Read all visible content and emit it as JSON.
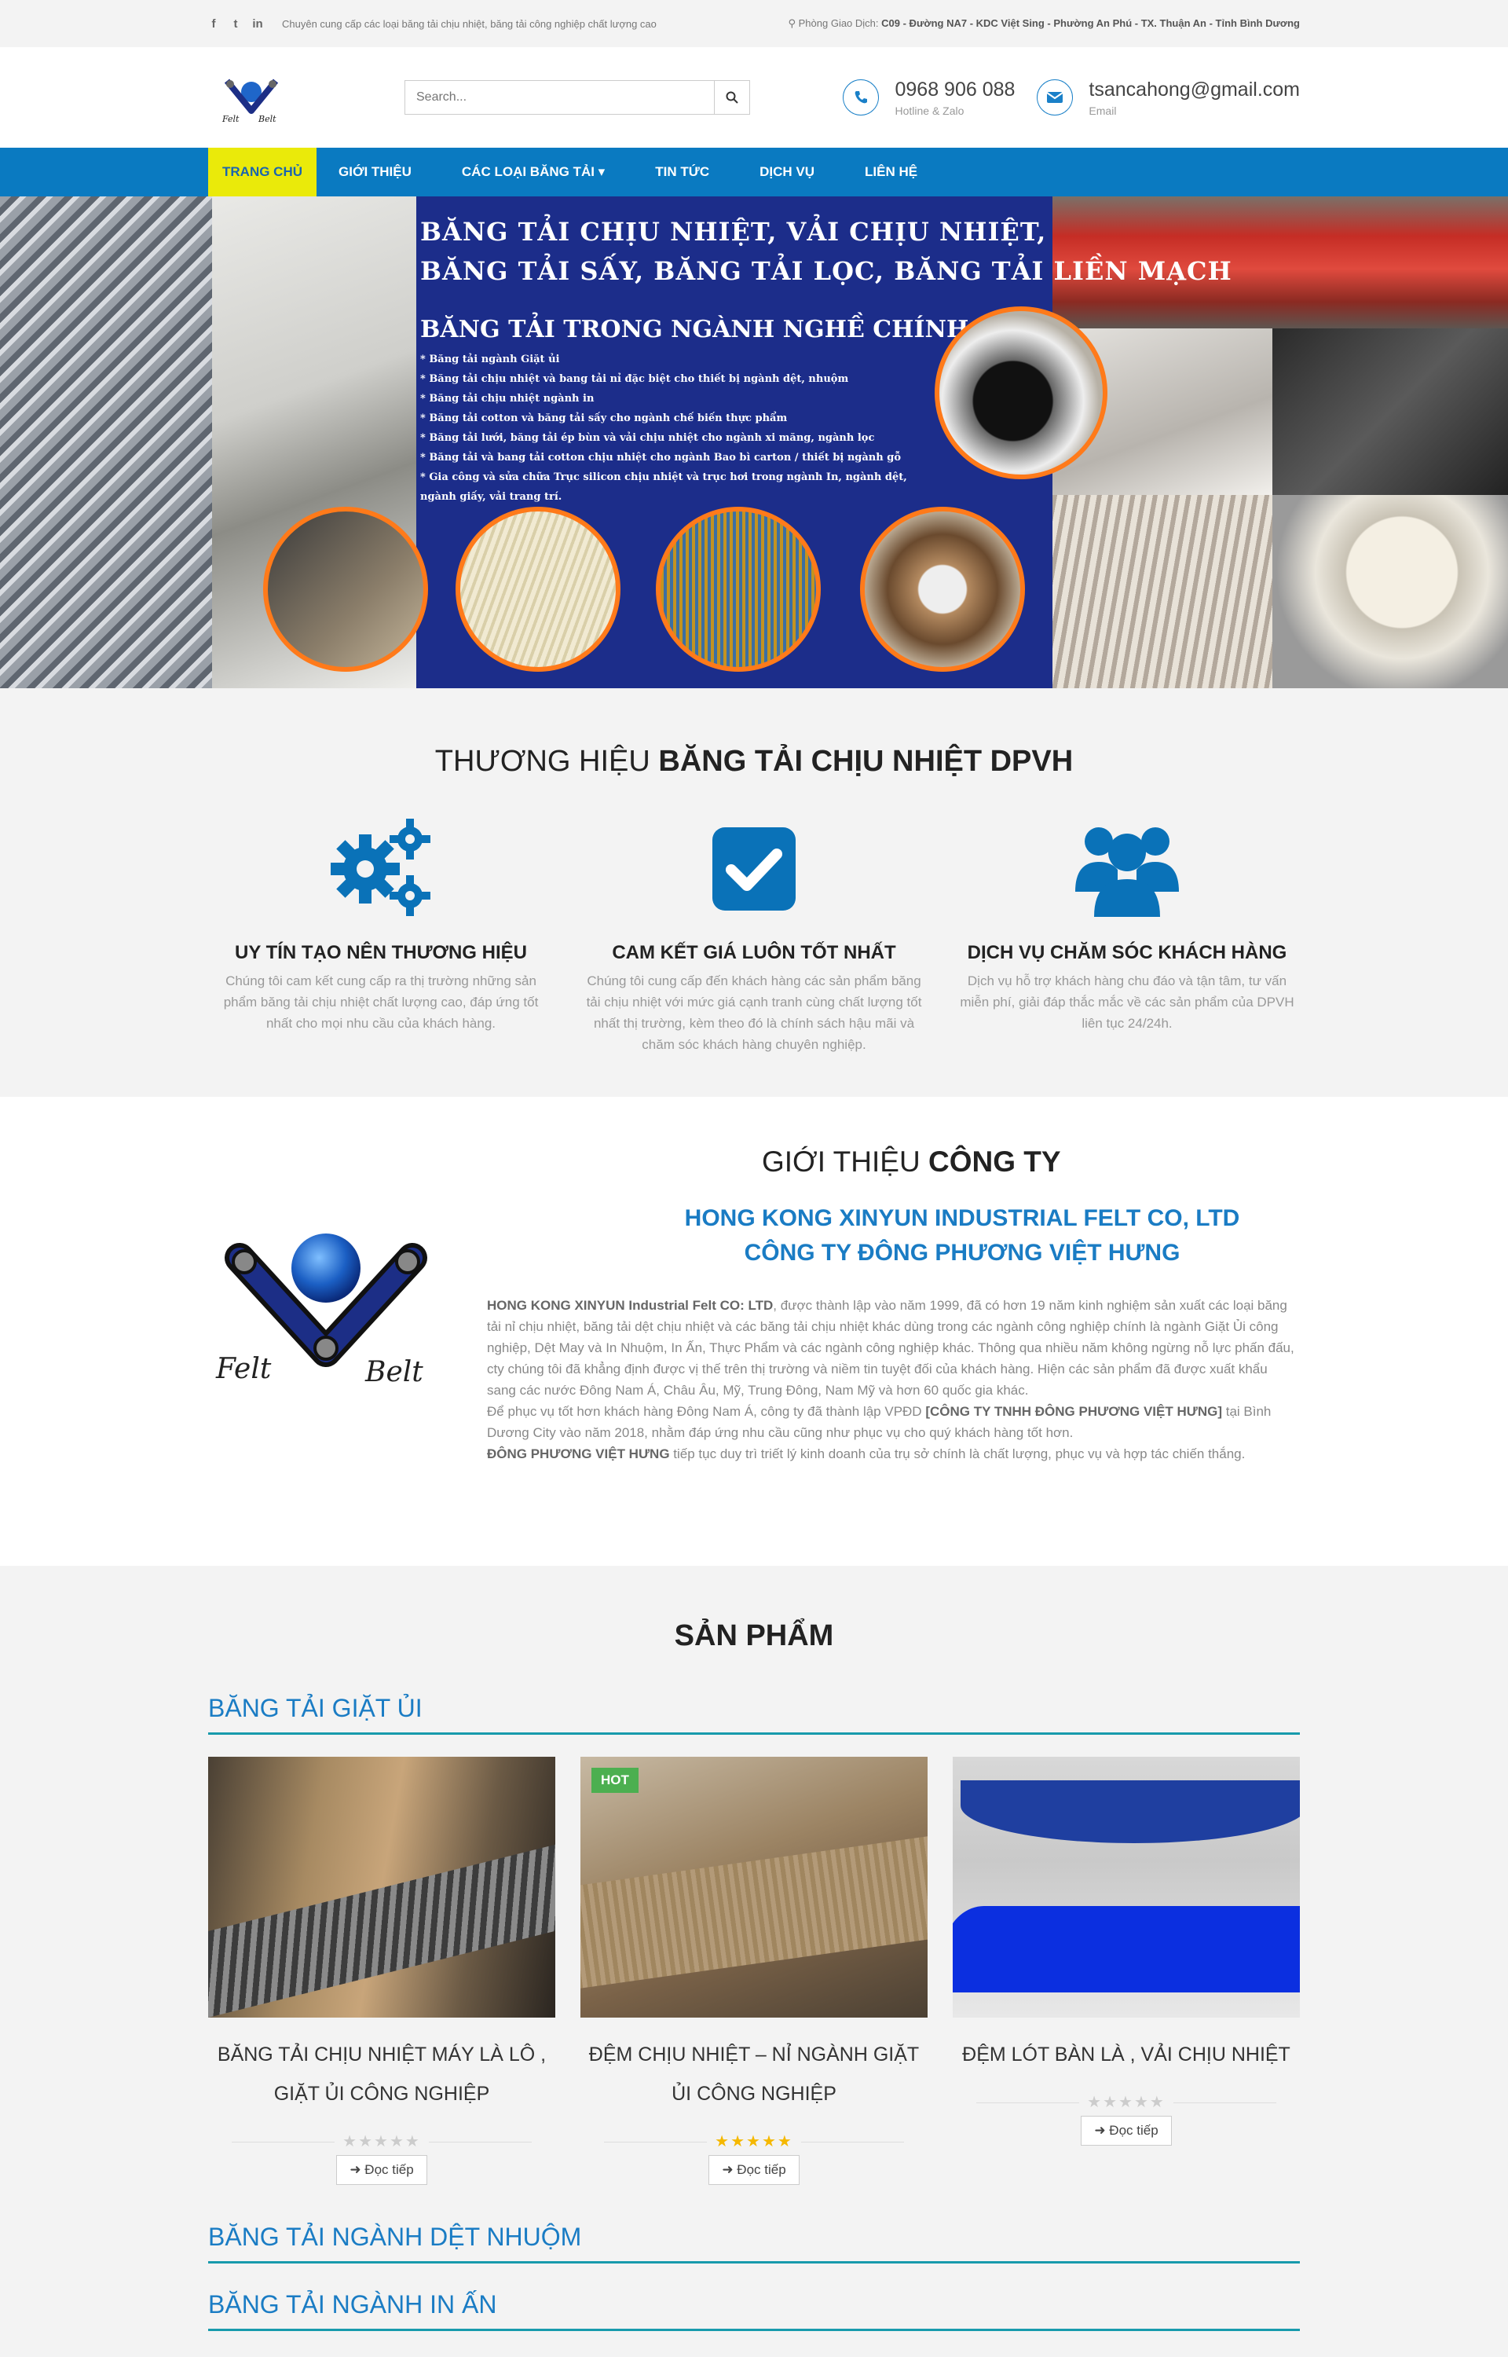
{
  "topbar": {
    "tagline": "Chuyên cung cấp các loại băng tải chịu nhiệt, băng tải công nghiệp chất lượng cao",
    "address_label": "Phòng Giao Dịch:",
    "address": "C09 - Đường NA7 - KDC Việt Sing - Phường An Phú - TX. Thuận An - Tỉnh Bình Dương",
    "social": [
      "f",
      "t",
      "in"
    ]
  },
  "header": {
    "search_placeholder": "Search...",
    "phone": "0968 906 088",
    "phone_label": "Hotline & Zalo",
    "email": "tsancahong@gmail.com",
    "email_label": "Email"
  },
  "nav": {
    "items": [
      {
        "label": "TRANG CHỦ"
      },
      {
        "label": "GIỚI THIỆU"
      },
      {
        "label": "CÁC LOẠI BĂNG TẢI ▾"
      },
      {
        "label": "TIN TỨC"
      },
      {
        "label": "DỊCH VỤ"
      },
      {
        "label": "LIÊN HỆ"
      }
    ]
  },
  "banner": {
    "line1": "BĂNG TẢI CHỊU NHIỆT, VẢI CHỊU NHIỆT,",
    "line2": "BĂNG TẢI SẤY, BĂNG TẢI LỌC, BĂNG TẢI LIỀN MẠCH",
    "subtitle": "BĂNG TẢI TRONG NGÀNH NGHỀ CHÍNH:",
    "items": [
      "* Băng tải ngành Giặt ủi",
      "* Băng tải chịu nhiệt và bang tải nỉ đặc biệt cho thiết bị ngành dệt, nhuộm",
      "* Băng tải chịu nhiệt ngành in",
      "* Băng tải cotton và băng tải sấy cho ngành chế biến thực phẩm",
      "* Băng tải lưới, băng tải ép bùn và vải chịu nhiệt cho ngành xi măng, ngành lọc",
      "* Băng tải và bang tải cotton chịu nhiệt cho ngành Bao bì carton / thiết bị ngành gỗ",
      "* Gia công và sửa chữa Trục silicon chịu nhiệt và trục hơi trong ngành In, ngành dệt, ngành giấy, vải trang trí."
    ]
  },
  "features": {
    "title_light": "THƯƠNG HIỆU",
    "title_bold": "BĂNG TẢI CHỊU NHIỆT DPVH",
    "items": [
      {
        "title": "UY TÍN TẠO NÊN THƯƠNG HIỆU",
        "text": "Chúng tôi cam kết cung cấp ra thị trường những sản phẩm băng tải chịu nhiệt chất lượng cao, đáp ứng tốt nhất cho mọi nhu cầu của khách hàng."
      },
      {
        "title": "CAM KẾT GIÁ LUÔN TỐT NHẤT",
        "text": "Chúng tôi cung cấp đến khách hàng các sản phẩm băng tải chịu nhiệt với mức giá cạnh tranh cùng chất lượng tốt nhất thị trường, kèm theo đó là chính sách hậu mãi và chăm sóc khách hàng chuyên nghiệp."
      },
      {
        "title": "DỊCH VỤ CHĂM SÓC KHÁCH HÀNG",
        "text": "Dịch vụ hỗ trợ khách hàng chu đáo và tận tâm, tư vấn miễn phí, giải đáp thắc mắc về các sản phẩm của DPVH liên tục 24/24h."
      }
    ]
  },
  "about": {
    "title_light": "GIỚI THIỆU",
    "title_bold": "CÔNG TY",
    "company_en": "HONG KONG XINYUN INDUSTRIAL FELT CO, LTD",
    "company_vn": "CÔNG TY ĐÔNG PHƯƠNG VIỆT HƯNG",
    "p1_bold": "HONG KONG XINYUN Industrial Felt CO: LTD",
    "p1": ", được thành lập vào năm 1999, đã có hơn 19 năm kinh nghiệm sản xuất các loại băng tải nỉ chịu nhiệt, băng tải dệt chịu nhiệt và các băng tải chịu nhiệt khác dùng trong các ngành công nghiệp chính là ngành Giặt Ủi công nghiệp, Dệt May và In Nhuộm, In Ấn, Thực Phẩm và các ngành công nghiệp khác. Thông qua nhiều năm không ngừng nỗ lực phấn đấu, cty chúng tôi đã khẳng định được vị thế trên thị trường và niềm tin tuyệt đối của khách hàng. Hiện các sản phẩm đã được xuất khẩu sang các nước Đông Nam Á, Châu Âu, Mỹ, Trung Đông, Nam Mỹ và hơn 60 quốc gia khác.",
    "p2_pre": "Để phục vụ tốt hơn khách hàng Đông Nam Á, công ty đã thành lập VPĐD ",
    "p2_bold": "[CÔNG TY TNHH ĐÔNG PHƯƠNG VIỆT HƯNG]",
    "p2_post": " tại Bình Dương City vào năm 2018, nhằm đáp ứng nhu cầu cũng như phục vụ cho quý khách hàng tốt hơn.",
    "p3_bold": "ĐÔNG PHƯƠNG VIỆT HƯNG",
    "p3": " tiếp tục duy trì triết lý kinh doanh của trụ sở chính là chất lượng, phục vụ và hợp tác chiến thắng."
  },
  "products": {
    "title": "SẢN PHẨM",
    "categories": [
      "BĂNG TẢI GIẶT ỦI",
      "BĂNG TẢI NGÀNH DỆT NHUỘM",
      "BĂNG TẢI NGÀNH IN ẤN"
    ],
    "items": [
      {
        "name": "BĂNG TẢI CHỊU NHIỆT MÁY LÀ LÔ , GIẶT ỦI CÔNG NGHIỆP",
        "rating": 0,
        "badge": "",
        "more": "Đọc tiếp"
      },
      {
        "name": "ĐỆM CHỊU NHIỆT – NỈ NGÀNH GIẶT ỦI CÔNG NGHIỆP",
        "rating": 5,
        "badge": "HOT",
        "more": "Đọc tiếp"
      },
      {
        "name": "ĐỆM LÓT BÀN LÀ , VẢI CHỊU NHIỆT",
        "rating": 0,
        "badge": "",
        "more": "Đọc tiếp"
      }
    ],
    "stars": "★★★★★"
  },
  "colors": {
    "primary": "#0a7ac1",
    "nav_active": "#eaea0a",
    "accent_text": "#1a7cc4",
    "hot_badge": "#4caf50",
    "star": "#f5b800"
  }
}
